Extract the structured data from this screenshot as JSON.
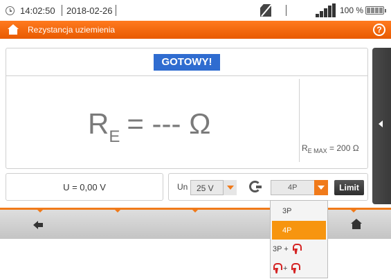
{
  "status_bar": {
    "time": "14:02:50",
    "date": "2018-02-26",
    "battery_percent": "100 %"
  },
  "title_bar": {
    "title": "Rezystancja uziemienia"
  },
  "display": {
    "status": "GOTOWY!",
    "result_symbol": "R",
    "result_subscript": "E",
    "result_value": "= --- Ω",
    "max_symbol": "R",
    "max_subscript": "E MAX",
    "max_value": "= 200 Ω"
  },
  "bottom_row": {
    "voltage_reading": "U = 0,00 V",
    "un_label": "Un",
    "un_value": "25 V",
    "mode_value": "4P",
    "limit_label": "Limit"
  },
  "dropdown": {
    "options": [
      "3P",
      "4P",
      "3P +",
      "+"
    ],
    "selected": "4P"
  },
  "colors": {
    "accent": "#f07a1a",
    "badge": "#2f6cd0",
    "selection": "#f7950f",
    "clamp": "#d42222"
  },
  "icons": [
    "clock-icon",
    "sd-card-icon",
    "signal-icon",
    "battery-icon",
    "home-icon",
    "help-icon",
    "arrow-left-icon",
    "clamp-icon",
    "back-icon"
  ]
}
